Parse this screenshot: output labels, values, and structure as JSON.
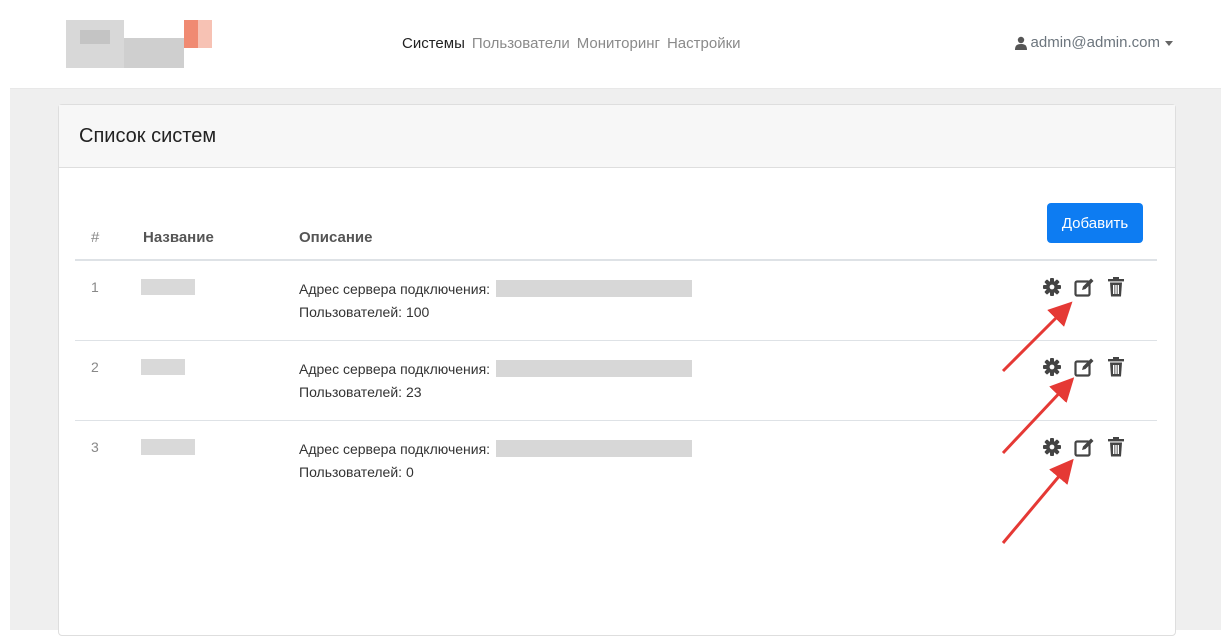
{
  "nav": {
    "links": [
      "Системы",
      "Пользователи",
      "Мониторинг",
      "Настройки"
    ],
    "active": "Системы",
    "user": "admin@admin.com"
  },
  "card": {
    "title": "Список систем",
    "add_label": "Добавить"
  },
  "table": {
    "columns": [
      "#",
      "Название",
      "Описание"
    ],
    "rows": [
      {
        "num": "1",
        "address_label": "Адрес сервера подключения:",
        "users": "Пользователей: 100"
      },
      {
        "num": "2",
        "address_label": "Адрес сервера подключения:",
        "users": "Пользователей: 23"
      },
      {
        "num": "3",
        "address_label": "Адрес сервера подключения:",
        "users": "Пользователей: 0"
      }
    ]
  },
  "icons": {
    "settings": "gear-icon",
    "edit": "edit-icon",
    "delete": "trash-icon",
    "user": "user-icon",
    "caret": "caret-down-icon"
  },
  "colors": {
    "primary": "#0d7cf2",
    "annotation": "#e53935"
  }
}
